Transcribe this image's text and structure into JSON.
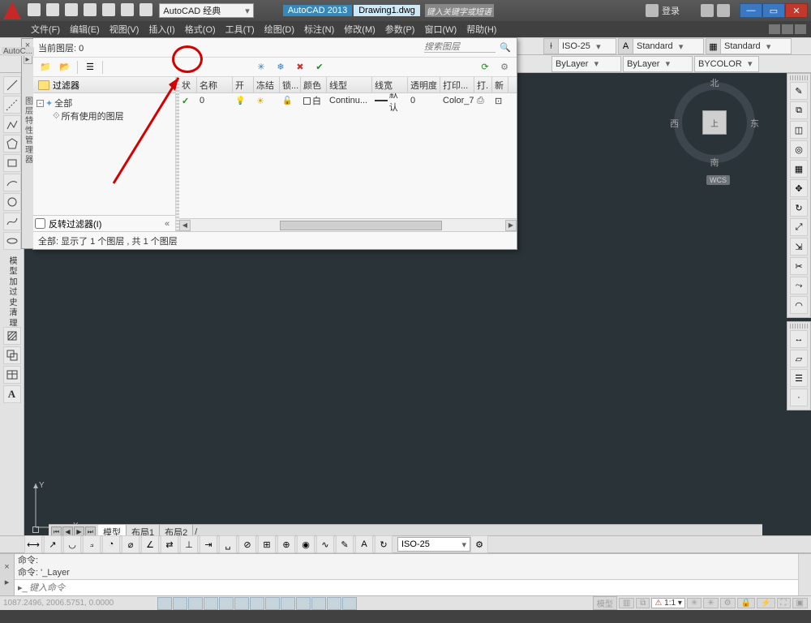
{
  "title": {
    "app_name": "AutoCAD 2013",
    "doc_name": "Drawing1.dwg",
    "workspace": "AutoCAD 经典",
    "keyword_placeholder": "键入关键字或短语",
    "login": "登录"
  },
  "menus": {
    "file": "文件(F)",
    "edit": "编辑(E)",
    "view": "视图(V)",
    "insert": "插入(I)",
    "format": "格式(O)",
    "tools": "工具(T)",
    "draw": "绘图(D)",
    "dimension": "标注(N)",
    "modify": "修改(M)",
    "parametric": "参数(P)",
    "window": "窗口(W)",
    "help": "帮助(H)"
  },
  "props": {
    "dimstyle": "ISO-25",
    "textstyle": "Standard",
    "tablestyle": "Standard",
    "color": "ByLayer",
    "ltype": "ByLayer",
    "bycolor": "BYCOLOR"
  },
  "tabs": {
    "model": "模型",
    "layout1": "布局1",
    "layout2": "布局2"
  },
  "dimbar": {
    "style": "ISO-25"
  },
  "cmd": {
    "hist1": "命令:",
    "hist2": "命令: '_Layer",
    "placeholder": "键入命令"
  },
  "status": {
    "coords": "1087.2496, 2006.5751, 0.0000",
    "modelspace": "模型",
    "annoscale": "1:1"
  },
  "compass": {
    "n": "北",
    "s": "南",
    "e": "东",
    "w": "西",
    "top": "上",
    "wcs": "WCS"
  },
  "panel": {
    "title_vertical": "图层特性管理器",
    "current_label": "当前图层: 0",
    "search_placeholder": "搜索图层",
    "filter_header": "过滤器",
    "tree_all": "全部",
    "tree_used": "所有使用的图层",
    "invert_filter": "反转过滤器(I)",
    "status_text": "全部: 显示了 1 个图层 , 共 1 个图层",
    "cols": {
      "status": "状",
      "name": "名称",
      "on": "开",
      "freeze": "冻结",
      "lock": "锁...",
      "color": "颜色",
      "ltype": "线型",
      "lweight": "线宽",
      "transp": "透明度",
      "plotstyle": "打印...",
      "plot": "打.",
      "new": "新"
    },
    "row0": {
      "name": "0",
      "color_name": "白",
      "ltype": "Continu...",
      "lweight": "默认",
      "transp": "0",
      "plotstyle": "Color_7"
    }
  }
}
